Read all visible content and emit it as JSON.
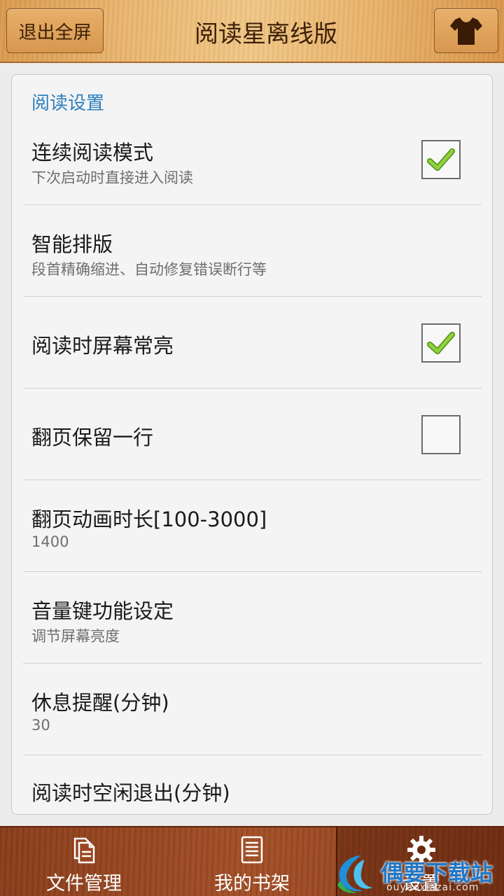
{
  "header": {
    "exit_fullscreen_label": "退出全屏",
    "title": "阅读星离线版",
    "skin_icon": "tshirt-icon"
  },
  "settings": {
    "section_title": "阅读设置",
    "items": [
      {
        "title": "连续阅读模式",
        "subtitle": "下次启动时直接进入阅读",
        "checked": true
      },
      {
        "title": "智能排版",
        "subtitle": "段首精确缩进、自动修复错误断行等"
      },
      {
        "title": "阅读时屏幕常亮",
        "checked": true
      },
      {
        "title": "翻页保留一行",
        "checked": false
      },
      {
        "title": "翻页动画时长[100-3000]",
        "subtitle": "1400"
      },
      {
        "title": "音量键功能设定",
        "subtitle": "调节屏幕亮度"
      },
      {
        "title": "休息提醒(分钟)",
        "subtitle": "30"
      },
      {
        "title": "阅读时空闲退出(分钟)"
      }
    ]
  },
  "bottom_nav": {
    "items": [
      {
        "label": "文件管理",
        "icon": "file-manage-icon"
      },
      {
        "label": "我的书架",
        "icon": "bookshelf-icon"
      },
      {
        "label": "设置",
        "icon": "gear-icon",
        "active": true
      }
    ]
  },
  "watermark": {
    "name": "偶要下载站",
    "url": "ouyaoxiazai.com"
  },
  "colors": {
    "accent": "#2a7fc0",
    "check_green": "#7cc130",
    "nav_bg": "#9a4622",
    "header_wood": "#e9b670"
  }
}
